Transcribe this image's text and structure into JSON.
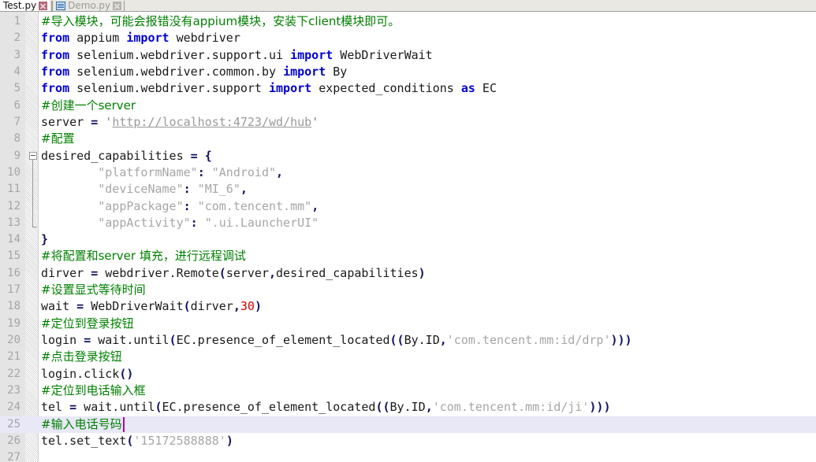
{
  "window": {
    "kind": "python-code-editor"
  },
  "tabbar": {
    "tabs": [
      {
        "label": "Test.py",
        "active": true,
        "icon": "python-file-icon",
        "close_icon": "close-icon"
      },
      {
        "label": "Demo.py",
        "active": false,
        "icon": "python-file-icon",
        "close_icon": "close-icon"
      }
    ]
  },
  "editor": {
    "current_line": 25,
    "total_visible_lines": 27,
    "colors": {
      "comment": "#008000",
      "keyword": "#0000d2",
      "string": "#a6a6a6",
      "number": "#d40000",
      "punctuation": "#101060",
      "plain": "#1a1a1a",
      "gutter_bg": "#e4e4e4",
      "gutter_number": "#a5a5a5",
      "current_line_bg": "#e8e8f7",
      "caret": "#b000b0",
      "background": "#ffffff"
    },
    "lines": [
      {
        "n": 1,
        "tokens": [
          {
            "t": "com",
            "v": "#导入模块，可能会报错没有appium模块，安装下client模块即可。"
          }
        ]
      },
      {
        "n": 2,
        "tokens": [
          {
            "t": "kw",
            "v": "from"
          },
          {
            "t": "plain",
            "v": " appium "
          },
          {
            "t": "kw",
            "v": "import"
          },
          {
            "t": "plain",
            "v": " webdriver"
          }
        ]
      },
      {
        "n": 3,
        "tokens": [
          {
            "t": "kw",
            "v": "from"
          },
          {
            "t": "plain",
            "v": " selenium.webdriver.support.ui "
          },
          {
            "t": "kw",
            "v": "import"
          },
          {
            "t": "plain",
            "v": " WebDriverWait"
          }
        ]
      },
      {
        "n": 4,
        "tokens": [
          {
            "t": "kw",
            "v": "from"
          },
          {
            "t": "plain",
            "v": " selenium.webdriver.common.by "
          },
          {
            "t": "kw",
            "v": "import"
          },
          {
            "t": "plain",
            "v": " By"
          }
        ]
      },
      {
        "n": 5,
        "tokens": [
          {
            "t": "kw",
            "v": "from"
          },
          {
            "t": "plain",
            "v": " selenium.webdriver.support "
          },
          {
            "t": "kw",
            "v": "import"
          },
          {
            "t": "plain",
            "v": " expected_conditions "
          },
          {
            "t": "kw",
            "v": "as"
          },
          {
            "t": "plain",
            "v": " EC"
          }
        ]
      },
      {
        "n": 6,
        "tokens": [
          {
            "t": "com",
            "v": "#创建一个server"
          }
        ]
      },
      {
        "n": 7,
        "tokens": [
          {
            "t": "plain",
            "v": "server "
          },
          {
            "t": "op",
            "v": "="
          },
          {
            "t": "plain",
            "v": " "
          },
          {
            "t": "strq",
            "v": "'"
          },
          {
            "t": "url",
            "v": "http://localhost:4723/wd/hub"
          },
          {
            "t": "strq",
            "v": "'"
          }
        ]
      },
      {
        "n": 8,
        "tokens": [
          {
            "t": "com",
            "v": "#配置"
          }
        ]
      },
      {
        "n": 9,
        "fold": "start",
        "tokens": [
          {
            "t": "plain",
            "v": "desired_capabilities "
          },
          {
            "t": "op",
            "v": "="
          },
          {
            "t": "plain",
            "v": " "
          },
          {
            "t": "pun",
            "v": "{"
          }
        ]
      },
      {
        "n": 10,
        "fold": "mid",
        "tokens": [
          {
            "t": "plain",
            "v": "        "
          },
          {
            "t": "str",
            "v": "\"platformName\""
          },
          {
            "t": "pun",
            "v": ":"
          },
          {
            "t": "plain",
            "v": " "
          },
          {
            "t": "str",
            "v": "\"Android\""
          },
          {
            "t": "pun",
            "v": ","
          }
        ]
      },
      {
        "n": 11,
        "fold": "mid",
        "tokens": [
          {
            "t": "plain",
            "v": "        "
          },
          {
            "t": "str",
            "v": "\"deviceName\""
          },
          {
            "t": "pun",
            "v": ":"
          },
          {
            "t": "plain",
            "v": " "
          },
          {
            "t": "str",
            "v": "\"MI_6\""
          },
          {
            "t": "pun",
            "v": ","
          }
        ]
      },
      {
        "n": 12,
        "fold": "mid",
        "tokens": [
          {
            "t": "plain",
            "v": "        "
          },
          {
            "t": "str",
            "v": "\"appPackage\""
          },
          {
            "t": "pun",
            "v": ":"
          },
          {
            "t": "plain",
            "v": " "
          },
          {
            "t": "str",
            "v": "\"com.tencent.mm\""
          },
          {
            "t": "pun",
            "v": ","
          }
        ]
      },
      {
        "n": 13,
        "fold": "end",
        "tokens": [
          {
            "t": "plain",
            "v": "        "
          },
          {
            "t": "str",
            "v": "\"appActivity\""
          },
          {
            "t": "pun",
            "v": ":"
          },
          {
            "t": "plain",
            "v": " "
          },
          {
            "t": "str",
            "v": "\".ui.LauncherUI\""
          }
        ]
      },
      {
        "n": 14,
        "tokens": [
          {
            "t": "pun",
            "v": "}"
          }
        ]
      },
      {
        "n": 15,
        "tokens": [
          {
            "t": "com",
            "v": "#将配置和server 填充，进行远程调试"
          }
        ]
      },
      {
        "n": 16,
        "tokens": [
          {
            "t": "plain",
            "v": "dirver "
          },
          {
            "t": "op",
            "v": "="
          },
          {
            "t": "plain",
            "v": " webdriver.Remote"
          },
          {
            "t": "pun",
            "v": "("
          },
          {
            "t": "plain",
            "v": "server"
          },
          {
            "t": "pun",
            "v": ","
          },
          {
            "t": "plain",
            "v": "desired_capabilities"
          },
          {
            "t": "pun",
            "v": ")"
          }
        ]
      },
      {
        "n": 17,
        "tokens": [
          {
            "t": "com",
            "v": "#设置显式等待时间"
          }
        ]
      },
      {
        "n": 18,
        "tokens": [
          {
            "t": "plain",
            "v": "wait "
          },
          {
            "t": "op",
            "v": "="
          },
          {
            "t": "plain",
            "v": " WebDriverWait"
          },
          {
            "t": "pun",
            "v": "("
          },
          {
            "t": "plain",
            "v": "dirver"
          },
          {
            "t": "pun",
            "v": ","
          },
          {
            "t": "num",
            "v": "30"
          },
          {
            "t": "pun",
            "v": ")"
          }
        ]
      },
      {
        "n": 19,
        "tokens": [
          {
            "t": "com",
            "v": "#定位到登录按钮"
          }
        ]
      },
      {
        "n": 20,
        "tokens": [
          {
            "t": "plain",
            "v": "login "
          },
          {
            "t": "op",
            "v": "="
          },
          {
            "t": "plain",
            "v": " wait.until"
          },
          {
            "t": "pun",
            "v": "("
          },
          {
            "t": "plain",
            "v": "EC.presence_of_element_located"
          },
          {
            "t": "pun",
            "v": "(("
          },
          {
            "t": "plain",
            "v": "By.ID"
          },
          {
            "t": "pun",
            "v": ","
          },
          {
            "t": "str",
            "v": "'com.tencent.mm:id/drp'"
          },
          {
            "t": "pun",
            "v": ")))"
          }
        ]
      },
      {
        "n": 21,
        "tokens": [
          {
            "t": "com",
            "v": "#点击登录按钮"
          }
        ]
      },
      {
        "n": 22,
        "tokens": [
          {
            "t": "plain",
            "v": "login.click"
          },
          {
            "t": "pun",
            "v": "()"
          }
        ]
      },
      {
        "n": 23,
        "tokens": [
          {
            "t": "com",
            "v": "#定位到电话输入框"
          }
        ]
      },
      {
        "n": 24,
        "tokens": [
          {
            "t": "plain",
            "v": "tel "
          },
          {
            "t": "op",
            "v": "="
          },
          {
            "t": "plain",
            "v": " wait.until"
          },
          {
            "t": "pun",
            "v": "("
          },
          {
            "t": "plain",
            "v": "EC.presence_of_element_located"
          },
          {
            "t": "pun",
            "v": "(("
          },
          {
            "t": "plain",
            "v": "By.ID"
          },
          {
            "t": "pun",
            "v": ","
          },
          {
            "t": "str",
            "v": "'com.tencent.mm:id/ji'"
          },
          {
            "t": "pun",
            "v": ")))"
          }
        ]
      },
      {
        "n": 25,
        "current": true,
        "caret_after": true,
        "tokens": [
          {
            "t": "com",
            "v": "#输入电话号码"
          }
        ]
      },
      {
        "n": 26,
        "tokens": [
          {
            "t": "plain",
            "v": "tel.set_text"
          },
          {
            "t": "pun",
            "v": "("
          },
          {
            "t": "str",
            "v": "'15172588888'"
          },
          {
            "t": "pun",
            "v": ")"
          }
        ]
      },
      {
        "n": 27,
        "tokens": []
      }
    ]
  }
}
